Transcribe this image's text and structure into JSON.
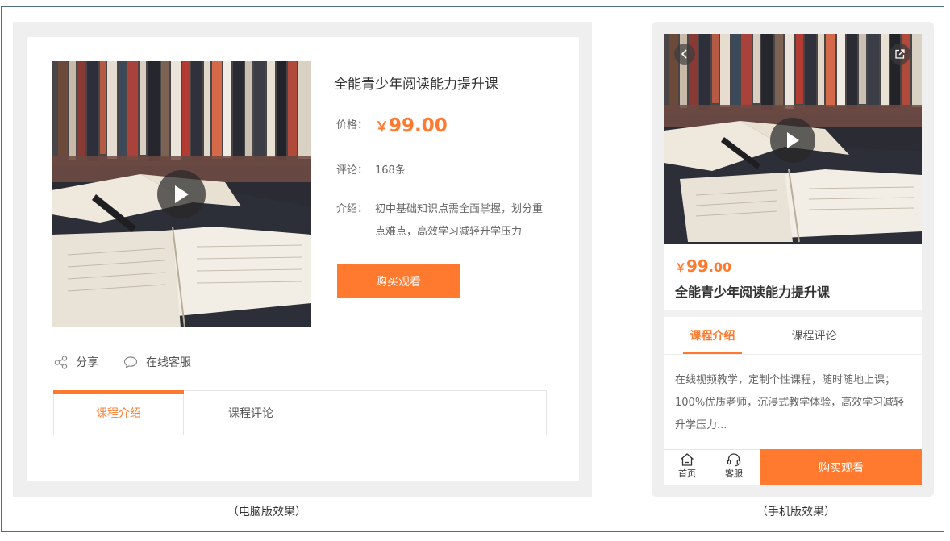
{
  "colors": {
    "accent": "#ff7a2f",
    "panel": "#efefef",
    "frame_border": "#4e6d83"
  },
  "desktop": {
    "title": "全能青少年阅读能力提升课",
    "price_label": "价格：",
    "price_symbol": "￥",
    "price_value": "99.00",
    "review_label": "评论：",
    "review_value": "168条",
    "intro_label": "介绍：",
    "intro_text": "初中基础知识点需全面掌握，划分重点难点，高效学习减轻升学压力",
    "buy_button": "购买观看",
    "actions": {
      "share": "分享",
      "service": "在线客服"
    },
    "tabs": [
      "课程介绍",
      "课程评论"
    ],
    "active_tab": 0,
    "caption": "（电脑版效果）"
  },
  "mobile": {
    "price_symbol": "￥",
    "price_int": "99",
    "price_dec": ".00",
    "title": "全能青少年阅读能力提升课",
    "tabs": [
      "课程介绍",
      "课程评论"
    ],
    "active_tab": 0,
    "description": "在线视频教学，定制个性课程，随时随地上课；100%优质老师，沉浸式教学体验，高效学习减轻升学压力...",
    "nav": {
      "home": "首页",
      "service": "客服"
    },
    "buy_button": "购买观看",
    "caption": "（手机版效果）"
  }
}
